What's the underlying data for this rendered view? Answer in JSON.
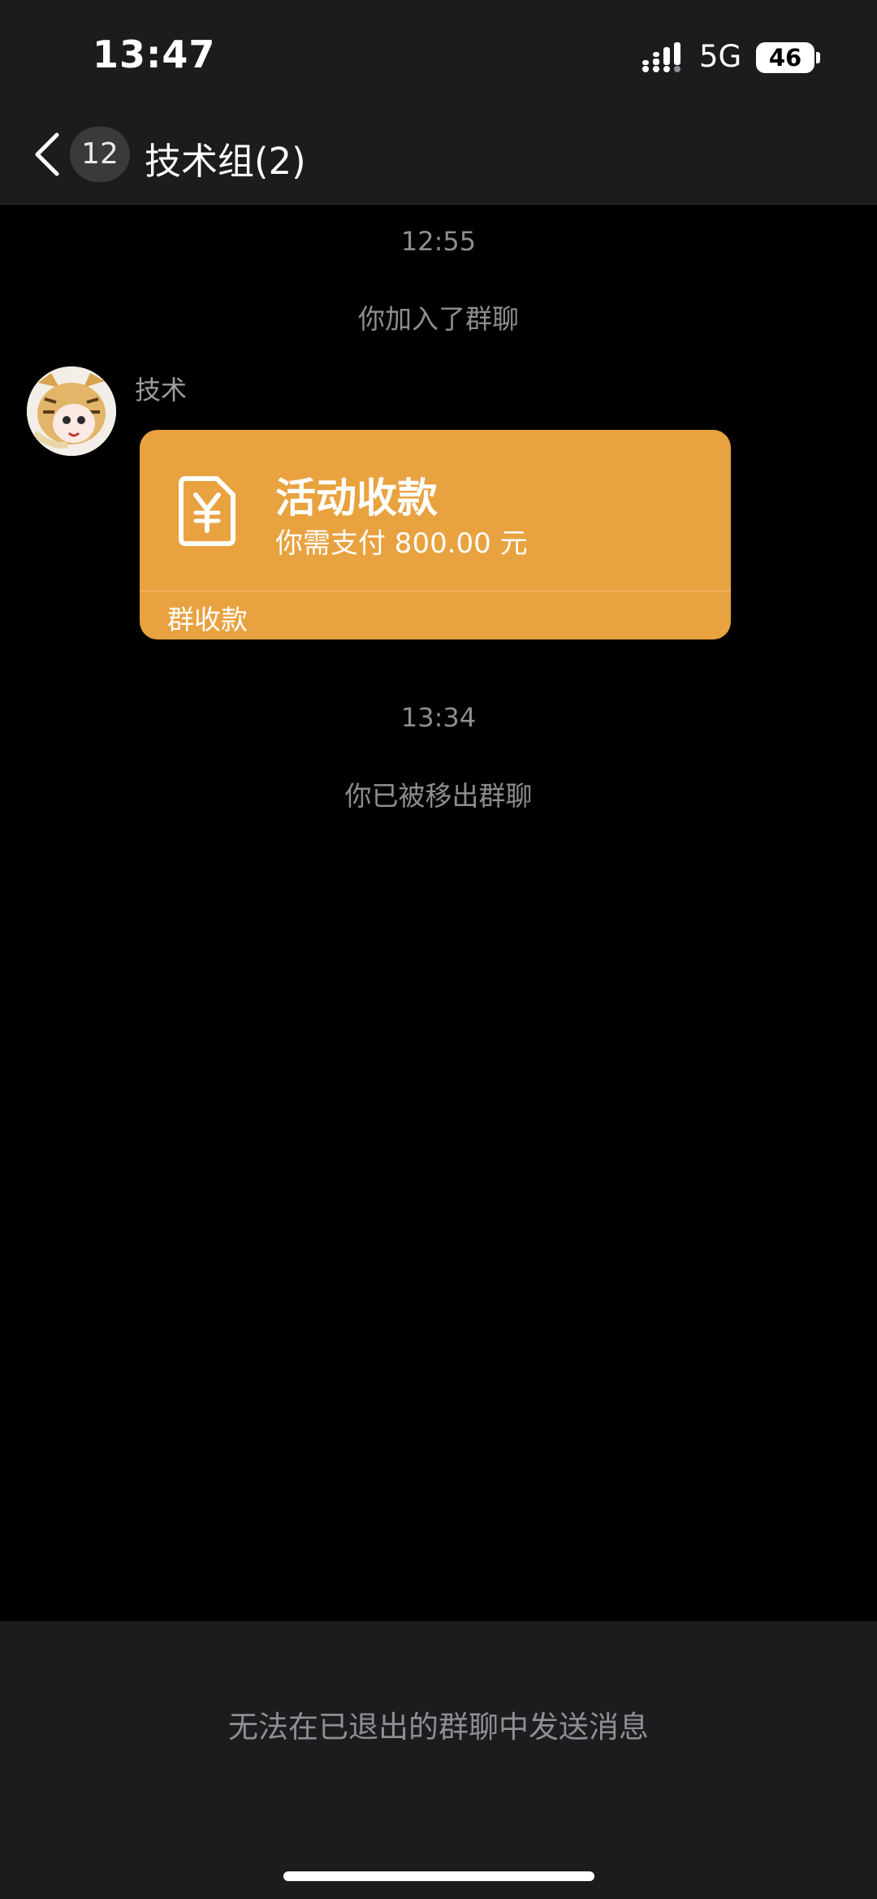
{
  "status_bar": {
    "time": "13:47",
    "network": "5G",
    "battery": "46"
  },
  "nav": {
    "unread_count": "12",
    "title": "技术组(2)"
  },
  "messages": {
    "timestamp_1": "12:55",
    "system_joined": "你加入了群聊",
    "sender_name": "技术",
    "payment_card": {
      "title": "活动收款",
      "subtitle": "你需支付 800.00 元",
      "footer": "群收款"
    },
    "timestamp_2": "13:34",
    "system_removed": "你已被移出群聊"
  },
  "bottom": {
    "notice": "无法在已退出的群聊中发送消息"
  },
  "colors": {
    "background": "#000000",
    "bar_background": "#1c1c1e",
    "payment_card": "#e8a23f",
    "muted_text": "#8d8d92"
  }
}
